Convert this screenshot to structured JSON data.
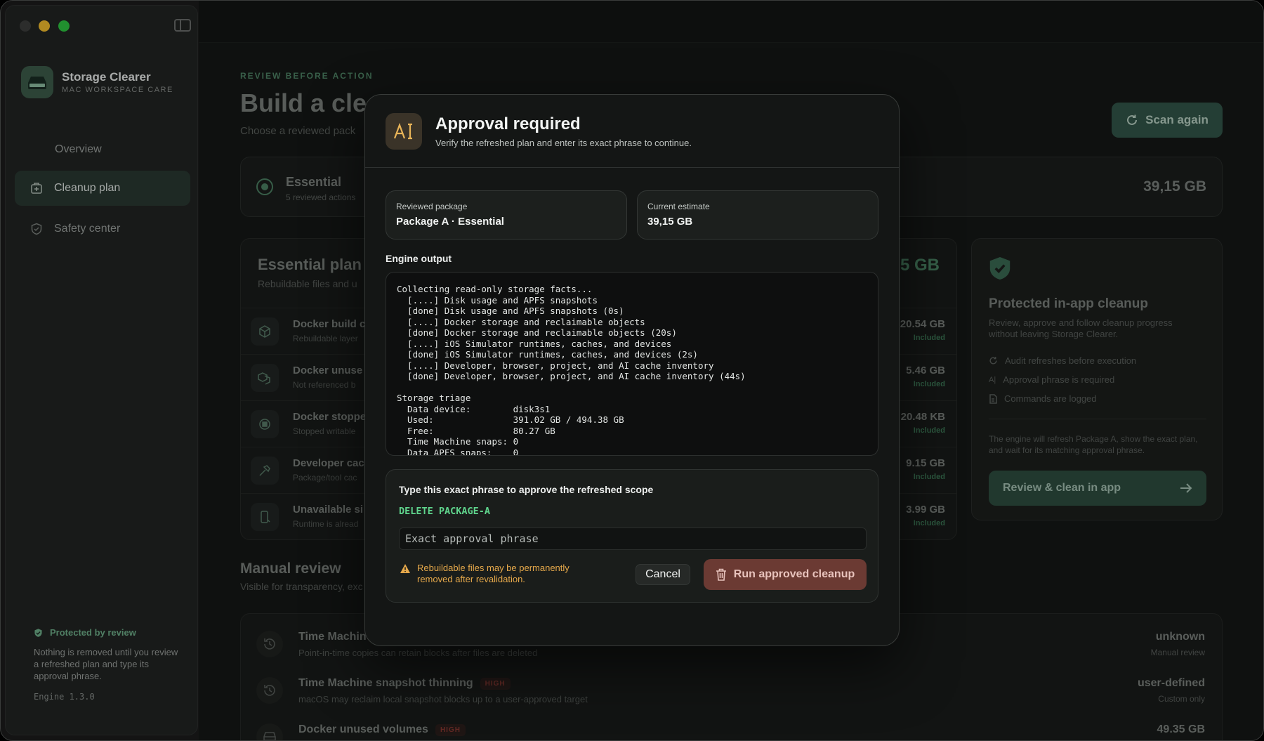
{
  "app": {
    "name": "Storage Clearer",
    "subtitle": "MAC WORKSPACE CARE"
  },
  "sidebar": {
    "items": [
      {
        "label": "Overview",
        "icon": "none"
      },
      {
        "label": "Cleanup plan",
        "icon": "cleanup-plan-icon",
        "selected": true
      },
      {
        "label": "Safety center",
        "icon": "shield-check-icon"
      }
    ],
    "protected": {
      "title": "Protected by review",
      "text": "Nothing is removed until you review a refreshed plan and type its approval phrase.",
      "engine_version": "Engine 1.3.0"
    }
  },
  "main": {
    "eyebrow": "REVIEW BEFORE ACTION",
    "title": "Build a clea",
    "subtitle": "Choose a reviewed pack",
    "scan_label": "Scan again",
    "package": {
      "name": "Essential",
      "count": "5 reviewed actions",
      "size": "39,15 GB"
    },
    "plan": {
      "title": "Essential plan",
      "subtitle": "Rebuildable files and u",
      "total": "5 GB",
      "rows": [
        {
          "title": "Docker build c",
          "sub": "Rebuildable layer",
          "value": "20.54 GB",
          "status": "Included",
          "icon": "cube-icon"
        },
        {
          "title": "Docker unuse",
          "sub": "Not referenced b",
          "value": "5.46 GB",
          "status": "Included",
          "icon": "cubes-icon"
        },
        {
          "title": "Docker stoppe",
          "sub": "Stopped writable",
          "value": "20.48 KB",
          "status": "Included",
          "icon": "stop-circle-icon"
        },
        {
          "title": "Developer cac",
          "sub": "Package/tool cac",
          "value": "9.15 GB",
          "status": "Included",
          "icon": "hammer-icon"
        },
        {
          "title": "Unavailable si",
          "sub": "Runtime is alread",
          "value": "3.99 GB",
          "status": "Included",
          "icon": "device-icon"
        }
      ]
    },
    "protect_panel": {
      "title": "Protected in-app cleanup",
      "subtitle": "Review, approve and follow cleanup progress without leaving Storage Clearer.",
      "items": [
        "Audit refreshes before execution",
        "Approval phrase is required",
        "Commands are logged"
      ],
      "note": "The engine will refresh Package A, show the exact plan, and wait for its matching approval phrase.",
      "button": "Review & clean in app"
    },
    "manual": {
      "title": "Manual review",
      "subtitle": "Visible for transparency, exc",
      "rows": [
        {
          "title": "Time Machine",
          "badge": "",
          "sub": "Point-in-time copies can retain blocks after files are deleted",
          "value": "unknown",
          "meta": "Manual review"
        },
        {
          "title": "Time Machine snapshot thinning",
          "badge": "HIGH",
          "sub": "macOS may reclaim local snapshot blocks up to a user-approved target",
          "value": "user-defined",
          "meta": "Custom only"
        },
        {
          "title": "Docker unused volumes",
          "badge": "HIGH",
          "sub": "",
          "value": "49.35 GB",
          "meta": ""
        }
      ]
    }
  },
  "modal": {
    "title": "Approval required",
    "subtitle": "Verify the refreshed plan and enter its exact phrase to continue.",
    "package_label": "Reviewed package",
    "package_value": "Package A · Essential",
    "estimate_label": "Current estimate",
    "estimate_value": "39,15 GB",
    "engine_label": "Engine output",
    "engine_output": "Collecting read-only storage facts...\n  [....] Disk usage and APFS snapshots\n  [done] Disk usage and APFS snapshots (0s)\n  [....] Docker storage and reclaimable objects\n  [done] Docker storage and reclaimable objects (20s)\n  [....] iOS Simulator runtimes, caches, and devices\n  [done] iOS Simulator runtimes, caches, and devices (2s)\n  [....] Developer, browser, project, and AI cache inventory\n  [done] Developer, browser, project, and AI cache inventory (44s)\n\nStorage triage\n  Data device:        disk3s1\n  Used:               391.02 GB / 494.38 GB\n  Free:               80.27 GB\n  Time Machine snaps: 0\n  Data APFS snaps:    0",
    "approve_title": "Type this exact phrase to approve the refreshed scope",
    "approve_phrase": "DELETE PACKAGE-A",
    "input_value": "",
    "input_placeholder": "Exact approval phrase",
    "warning": "Rebuildable files may be permanently removed after revalidation.",
    "cancel_label": "Cancel",
    "run_label": "Run approved cleanup"
  },
  "colors": {
    "accent": "#5fd48c",
    "warning": "#e6a94b",
    "danger_button": "#6b3a33",
    "brand": "#3d5e4c"
  }
}
